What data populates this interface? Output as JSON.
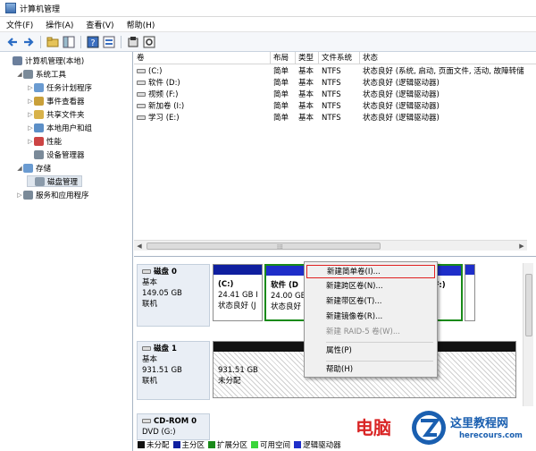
{
  "window": {
    "title": "计算机管理"
  },
  "menu": [
    "文件(F)",
    "操作(A)",
    "查看(V)",
    "帮助(H)"
  ],
  "toolbar": [
    "back-icon",
    "forward-icon",
    "up-folder-icon",
    "console-tree-icon",
    "help-icon",
    "properties-icon",
    "export-icon",
    "refresh-icon"
  ],
  "tree": [
    {
      "label": "计算机管理(本地)",
      "level": 0,
      "expander": "",
      "icon": "computer-icon",
      "color": "#6b7f9c"
    },
    {
      "label": "系统工具",
      "level": 1,
      "expander": "◢",
      "icon": "tools-icon",
      "color": "#7a8a99"
    },
    {
      "label": "任务计划程序",
      "level": 2,
      "expander": "▷",
      "icon": "clock-icon",
      "color": "#6a9bd1"
    },
    {
      "label": "事件查看器",
      "level": 2,
      "expander": "▷",
      "icon": "event-viewer-icon",
      "color": "#c9a03a"
    },
    {
      "label": "共享文件夹",
      "level": 2,
      "expander": "▷",
      "icon": "shared-folder-icon",
      "color": "#d8b24a"
    },
    {
      "label": "本地用户和组",
      "level": 2,
      "expander": "▷",
      "icon": "users-icon",
      "color": "#5c8fc7"
    },
    {
      "label": "性能",
      "level": 2,
      "expander": "▷",
      "icon": "performance-icon",
      "color": "#c44"
    },
    {
      "label": "设备管理器",
      "level": 2,
      "expander": "",
      "icon": "device-manager-icon",
      "color": "#7a8a99"
    },
    {
      "label": "存储",
      "level": 1,
      "expander": "◢",
      "icon": "storage-icon",
      "color": "#6a9bd1"
    },
    {
      "label": "磁盘管理",
      "level": 2,
      "expander": "",
      "icon": "disk-management-icon",
      "color": "#8a9aaa",
      "selected": true
    },
    {
      "label": "服务和应用程序",
      "level": 1,
      "expander": "▷",
      "icon": "services-icon",
      "color": "#7a8a99"
    }
  ],
  "volume_columns": [
    "卷",
    "布局",
    "类型",
    "文件系统",
    "状态"
  ],
  "volumes": [
    [
      "(C:)",
      "简单",
      "基本",
      "NTFS",
      "状态良好 (系统, 启动, 页面文件, 活动, 故障转储"
    ],
    [
      "软件 (D:)",
      "简单",
      "基本",
      "NTFS",
      "状态良好 (逻辑驱动器)"
    ],
    [
      "视频 (F:)",
      "简单",
      "基本",
      "NTFS",
      "状态良好 (逻辑驱动器)"
    ],
    [
      "新加卷 (I:)",
      "简单",
      "基本",
      "NTFS",
      "状态良好 (逻辑驱动器)"
    ],
    [
      "学习 (E:)",
      "简单",
      "基本",
      "NTFS",
      "状态良好 (逻辑驱动器)"
    ]
  ],
  "disks": [
    {
      "name": "磁盘 0",
      "type": "基本",
      "size": "149.05 GB",
      "status": "联机"
    },
    {
      "name": "磁盘 1",
      "type": "基本",
      "size": "931.51 GB",
      "status": "联机"
    },
    {
      "name": "CD-ROM 0",
      "type": "DVD (G:)",
      "size": "",
      "status": ""
    }
  ],
  "disk0_partitions": [
    {
      "label": "(C:)",
      "size": "24.41 GB I",
      "status": "状态良好 (J"
    },
    {
      "label": "软件 (D",
      "size": "24.00 GB",
      "status": "状态良好 ("
    },
    {
      "label": "F:)",
      "size": "",
      "status": ""
    }
  ],
  "disk1_unallocated": {
    "size": "931.51 GB",
    "label": "未分配"
  },
  "context_menu": {
    "items": [
      {
        "label": "新建简单卷(I)...",
        "disabled": false,
        "highlighted": true
      },
      {
        "label": "新建跨区卷(N)...",
        "disabled": false
      },
      {
        "label": "新建带区卷(T)...",
        "disabled": false
      },
      {
        "label": "新建镜像卷(R)...",
        "disabled": false
      },
      {
        "label": "新建 RAID-5 卷(W)...",
        "disabled": true
      },
      {
        "label": "属性(P)",
        "disabled": false
      },
      {
        "label": "帮助(H)",
        "disabled": false
      }
    ],
    "highlight_color": "#e02020"
  },
  "legend": [
    {
      "label": "未分配",
      "color": "#111111"
    },
    {
      "label": "主分区",
      "color": "#0f1f9f"
    },
    {
      "label": "扩展分区",
      "color": "#1a8a1a"
    },
    {
      "label": "可用空间",
      "color": "#3ad63a"
    },
    {
      "label": "逻辑驱动器",
      "color": "#1e2ec9"
    }
  ],
  "watermark": {
    "text": "电脑",
    "site": "这里教程网",
    "url": "herecours.com"
  }
}
